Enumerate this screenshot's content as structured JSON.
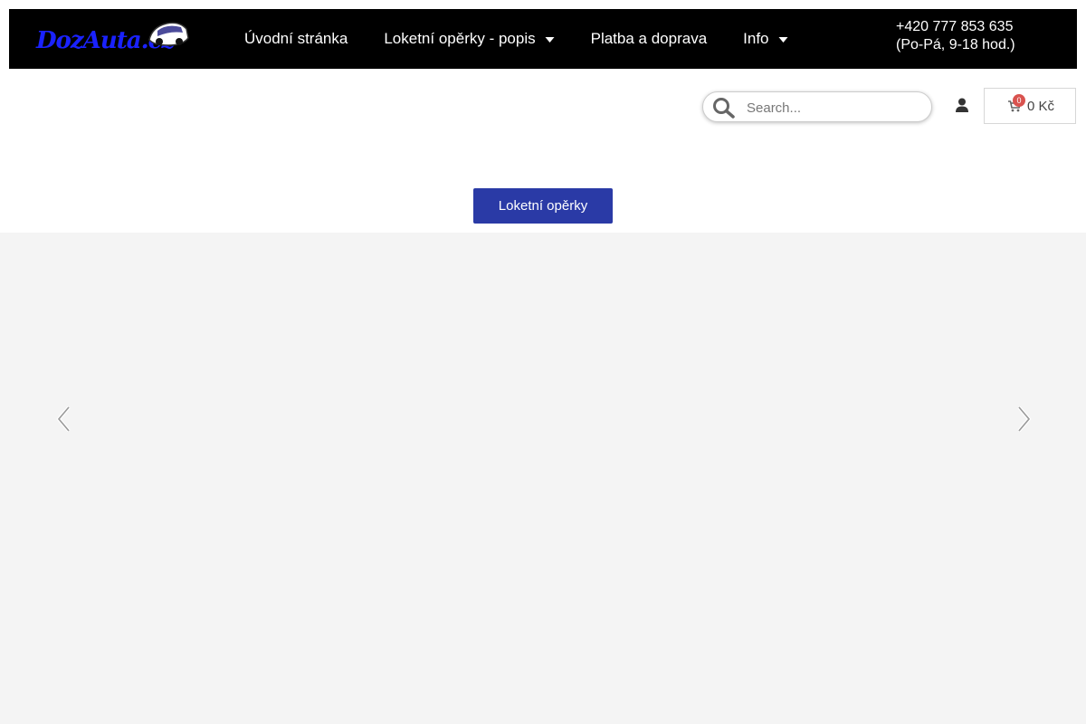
{
  "header": {
    "logo_text": "DozAuta.cz",
    "nav": [
      {
        "label": "Úvodní stránka",
        "has_dropdown": false
      },
      {
        "label": "Loketní opěrky - popis",
        "has_dropdown": true
      },
      {
        "label": "Platba a doprava",
        "has_dropdown": false
      },
      {
        "label": "Info",
        "has_dropdown": true
      }
    ],
    "phone": "+420 777 853 635",
    "hours": "(Po-Pá, 9-18 hod.)"
  },
  "search": {
    "placeholder": "Search..."
  },
  "cart": {
    "count": "0",
    "total": "0 Kč"
  },
  "cta": {
    "label": "Loketní opěrky"
  },
  "colors": {
    "topbar": "#000000",
    "logo": "#1a22ff",
    "cta": "#2a3aa6",
    "badge": "#d9534f",
    "slider_bg": "#f4f4f4"
  },
  "icons": [
    "car-logo-icon",
    "chevron-down-icon",
    "search-icon",
    "user-icon",
    "cart-icon",
    "arrow-left-icon",
    "arrow-right-icon"
  ]
}
